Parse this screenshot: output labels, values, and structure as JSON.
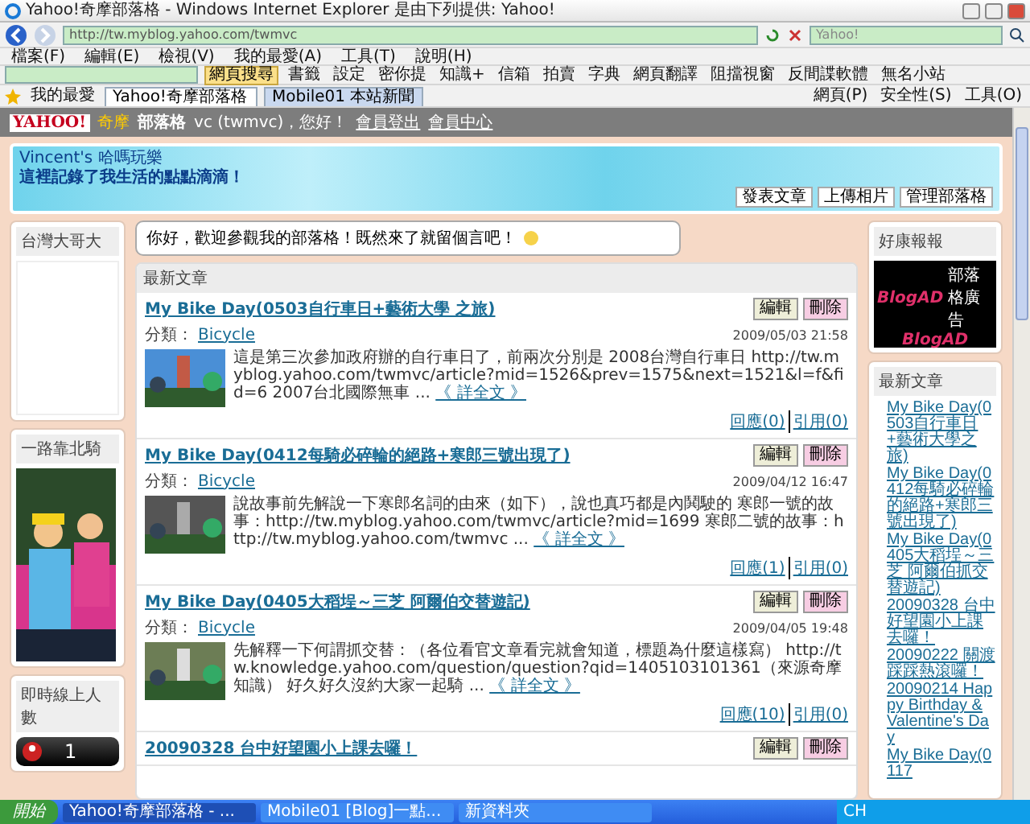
{
  "window": {
    "title": "Yahoo!奇摩部落格 - Windows Internet Explorer 是由下列提供: Yahoo!"
  },
  "address_bar": {
    "url": "http://tw.myblog.yahoo.com/twmvc",
    "search_placeholder": "Yahoo!"
  },
  "menu": [
    "檔案(F)",
    "編輯(E)",
    "檢視(V)",
    "我的最愛(A)",
    "工具(T)",
    "說明(H)"
  ],
  "toolbar": {
    "search_button": "網頁搜尋",
    "items": [
      "書籤",
      "設定",
      "密你提",
      "知識+",
      "信箱",
      "拍賣",
      "字典",
      "網頁翻譯",
      "阻擋視窗",
      "反間諜軟體",
      "無名小站"
    ]
  },
  "tabs_bar": {
    "favorites": "我的最愛",
    "tabs": [
      {
        "label": "Yahoo!奇摩部落格",
        "selected": true
      },
      {
        "label": "Mobile01 本站新聞",
        "selected": false
      }
    ],
    "commands": [
      "網頁(P)",
      "安全性(S)",
      "工具(O)"
    ]
  },
  "site_header": {
    "logo": "YAHOO!",
    "logo_sub": "奇摩",
    "section": "部落格",
    "greeting": "vc (twmvc)，您好！",
    "links": [
      "會員登出",
      "會員中心"
    ]
  },
  "banner": {
    "title": "Vincent's 哈嗎玩樂",
    "subtitle": "這裡記錄了我生活的點點滴滴！",
    "actions": [
      "發表文章",
      "上傳相片",
      "管理部落格"
    ]
  },
  "greeting_bubble": "你好，歡迎參觀我的部落格！既然來了就留個言吧！",
  "left_sidebar": [
    {
      "kind": "blank",
      "title": "台灣大哥大"
    },
    {
      "title": "一路靠北騎"
    },
    {
      "kind": "counter",
      "title": "即時線上人數",
      "count": "1"
    }
  ],
  "posts_panel": {
    "title": "最新文章",
    "posts": [
      {
        "title": "My Bike Day(0503自行車日+藝術大學 之旅)",
        "buttons": [
          "編輯",
          "刪除"
        ],
        "category_label": "分類：",
        "category": "Bicycle",
        "date": "2009/05/03 21:58",
        "excerpt": "這是第三次參加政府辦的自行車日了，前兩次分別是 2008台灣自行車日 http://tw.myblog.yahoo.com/twmvc/article?mid=1526&prev=1575&next=1521&l=f&fid=6 2007台北國際無車 ...",
        "more": "《 詳全文 》",
        "replies": "回應(0)",
        "trackbacks": "引用(0)"
      },
      {
        "title": "My Bike Day(0412每騎必碎輪的絕路+寒郎三號出現了)",
        "buttons": [
          "編輯",
          "刪除"
        ],
        "category_label": "分類：",
        "category": "Bicycle",
        "date": "2009/04/12 16:47",
        "excerpt": "說故事前先解說一下寒郎名詞的由來（如下），說也真巧都是內鬨駛的 寒郎一號的故事：http://tw.myblog.yahoo.com/twmvc/article?mid=1699 寒郎二號的故事：http://tw.myblog.yahoo.com/twmvc ...",
        "more": "《 詳全文 》",
        "replies": "回應(1)",
        "trackbacks": "引用(0)"
      },
      {
        "title": "My Bike Day(0405大稻埕～三芝 阿爾伯交替遊記)",
        "buttons": [
          "編輯",
          "刪除"
        ],
        "category_label": "分類：",
        "category": "Bicycle",
        "date": "2009/04/05 19:48",
        "excerpt": "先解釋一下何謂抓交替：（各位看官文章看完就會知道，標題為什麼這樣寫） http://tw.knowledge.yahoo.com/question/question?qid=1405103101361（來源奇摩知識） 好久好久沒約大家一起騎 ...",
        "more": "《 詳全文 》",
        "replies": "回應(10)",
        "trackbacks": "引用(0)"
      },
      {
        "title": "20090328 台中好望園小上課去囉！",
        "buttons": [
          "編輯",
          "刪除"
        ]
      }
    ]
  },
  "right_sidebar": {
    "ad": {
      "title": "好康報報",
      "brand": "BlogAD",
      "tag": "部落格廣告",
      "footer": "BlogAD"
    },
    "recent": {
      "title": "最新文章",
      "items": [
        "My Bike Day(0503自行車日+藝術大學之旅)",
        "My Bike Day(0412每騎必碎輪的絕路+寒郎三號出現了)",
        "My Bike Day(0405大稻埕～三芝 阿爾伯抓交替遊記)",
        "20090328 台中好望園小上課去囉！",
        "20090222 關渡踩踩熱滾囉！",
        "20090214 Happy Birthday & Valentine's Day",
        "My Bike Day(0117"
      ]
    }
  },
  "taskbar": {
    "start": "開始",
    "tasks": [
      {
        "label": "Yahoo!奇摩部落格 - ...",
        "selected": true
      },
      {
        "label": "Mobile01 [Blog]一點...",
        "selected": false
      },
      {
        "label": "新資料夾",
        "selected": false
      }
    ],
    "language": "CH"
  }
}
